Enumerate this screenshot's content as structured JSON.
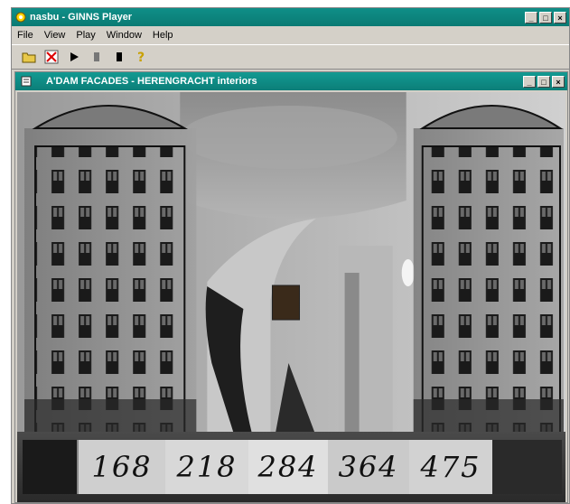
{
  "app": {
    "title": "nasbu - GINNS Player"
  },
  "menu": [
    "File",
    "View",
    "Play",
    "Window",
    "Help"
  ],
  "toolbar": {
    "icons": [
      "open-folder-icon",
      "stop-x-icon",
      "play-icon",
      "pause-icon",
      "stop-icon",
      "help-icon"
    ]
  },
  "child_window": {
    "title": "A'DAM FACADES - HERENGRACHT interiors"
  },
  "house_numbers": [
    "168",
    "218",
    "284",
    "364",
    "475"
  ],
  "colors": {
    "titlebar": "#0a7a74",
    "chrome": "#d4d0c8"
  }
}
